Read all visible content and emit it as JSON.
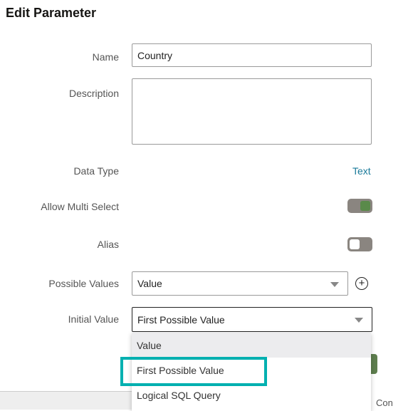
{
  "dialog": {
    "title": "Edit Parameter"
  },
  "fields": {
    "name": {
      "label": "Name",
      "value": "Country"
    },
    "description": {
      "label": "Description",
      "value": ""
    },
    "data_type": {
      "label": "Data Type",
      "value": "Text"
    },
    "allow_multi_select": {
      "label": "Allow Multi Select",
      "on": true
    },
    "alias": {
      "label": "Alias",
      "on": false
    },
    "possible_values": {
      "label": "Possible Values",
      "value": "Value"
    },
    "initial_value": {
      "label": "Initial Value",
      "value": "First Possible Value"
    }
  },
  "dropdown": {
    "options": [
      "Value",
      "First Possible Value",
      "Logical SQL Query"
    ],
    "hovered": "Value",
    "highlighted": "First Possible Value"
  },
  "footer": {
    "partial_text": "Con"
  },
  "colors": {
    "accent": "#1a7a9a",
    "toggle_on": "#5a8a4a",
    "highlight": "#00b0b0"
  }
}
